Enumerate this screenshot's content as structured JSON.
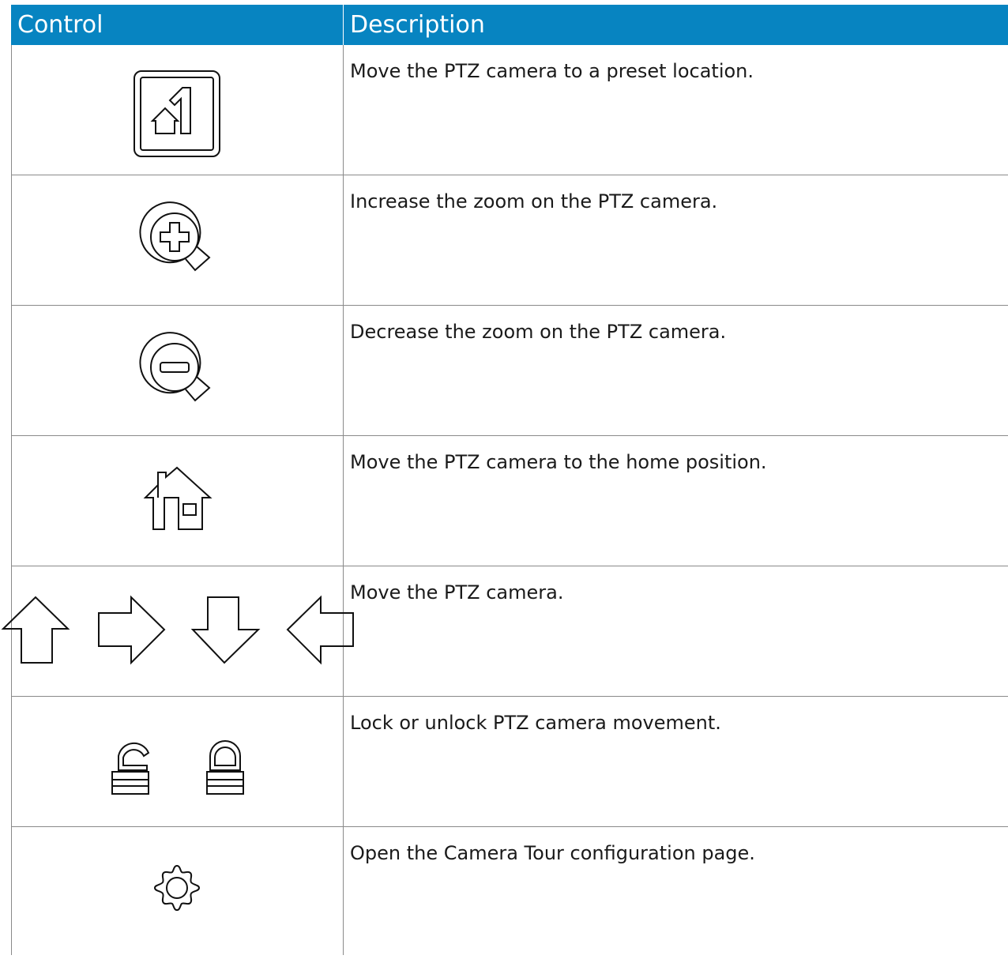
{
  "table": {
    "headers": {
      "control": "Control",
      "description": "Description"
    },
    "header_color": "#0784c1",
    "rows": [
      {
        "icons": [
          "preset-location-icon"
        ],
        "description": "Move the PTZ camera to a preset location."
      },
      {
        "icons": [
          "zoom-in-icon"
        ],
        "description": "Increase the zoom on the PTZ camera."
      },
      {
        "icons": [
          "zoom-out-icon"
        ],
        "description": "Decrease the zoom on the PTZ camera."
      },
      {
        "icons": [
          "home-icon"
        ],
        "description": "Move the PTZ camera to the home position."
      },
      {
        "icons": [
          "arrow-up-icon",
          "arrow-right-icon",
          "arrow-down-icon",
          "arrow-left-icon"
        ],
        "description": "Move the PTZ camera."
      },
      {
        "icons": [
          "unlock-icon",
          "lock-icon"
        ],
        "description": "Lock or unlock PTZ camera movement."
      },
      {
        "icons": [
          "gear-icon"
        ],
        "description": "Open the Camera Tour configuration page."
      }
    ]
  }
}
